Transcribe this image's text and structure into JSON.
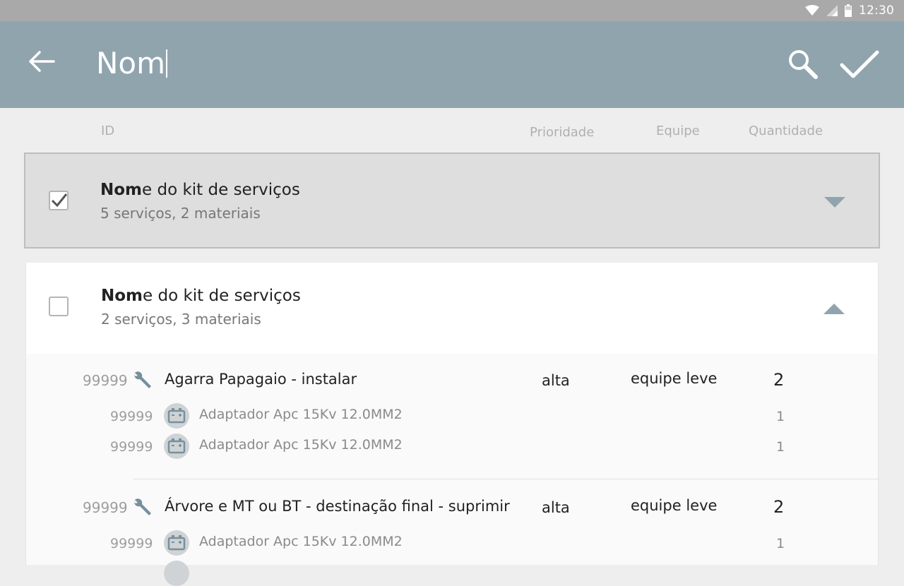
{
  "status_bar": {
    "time": "12:30",
    "icons": [
      "wifi-icon",
      "signal-icon",
      "battery-icon"
    ]
  },
  "app_bar": {
    "search_value": "Nom",
    "icons": [
      "back-arrow-icon",
      "search-icon",
      "check-icon"
    ],
    "color": "#90a4ae"
  },
  "columns": {
    "id": "ID",
    "priority": "Prioridade",
    "team": "Equipe",
    "quantity": "Quantidade"
  },
  "kits": [
    {
      "title_match": "Nom",
      "title_rest": "e do kit de serviços",
      "subtitle": "5 serviços, 2 materiais",
      "checked": true,
      "expanded": false
    },
    {
      "title_match": "Nom",
      "title_rest": "e do kit de serviços",
      "subtitle": "2 serviços, 3 materiais",
      "checked": false,
      "expanded": true,
      "services": [
        {
          "id": "99999",
          "icon": "wrench-icon",
          "name": "Agarra Papagaio - instalar",
          "priority": "alta",
          "team": "equipe leve",
          "quantity": "2",
          "materials": [
            {
              "id": "99999",
              "icon": "battery-material-icon",
              "name": "Adaptador Apc 15Kv 12.0MM2",
              "quantity": "1"
            },
            {
              "id": "99999",
              "icon": "battery-material-icon",
              "name": "Adaptador Apc 15Kv 12.0MM2",
              "quantity": "1"
            }
          ]
        },
        {
          "id": "99999",
          "icon": "wrench-icon",
          "name": "Árvore e MT ou BT - destinação final - suprimir",
          "priority": "alta",
          "team": "equipe leve",
          "quantity": "2",
          "materials": [
            {
              "id": "99999",
              "icon": "battery-material-icon",
              "name": "Adaptador Apc 15Kv 12.0MM2",
              "quantity": "1"
            }
          ]
        }
      ]
    }
  ]
}
